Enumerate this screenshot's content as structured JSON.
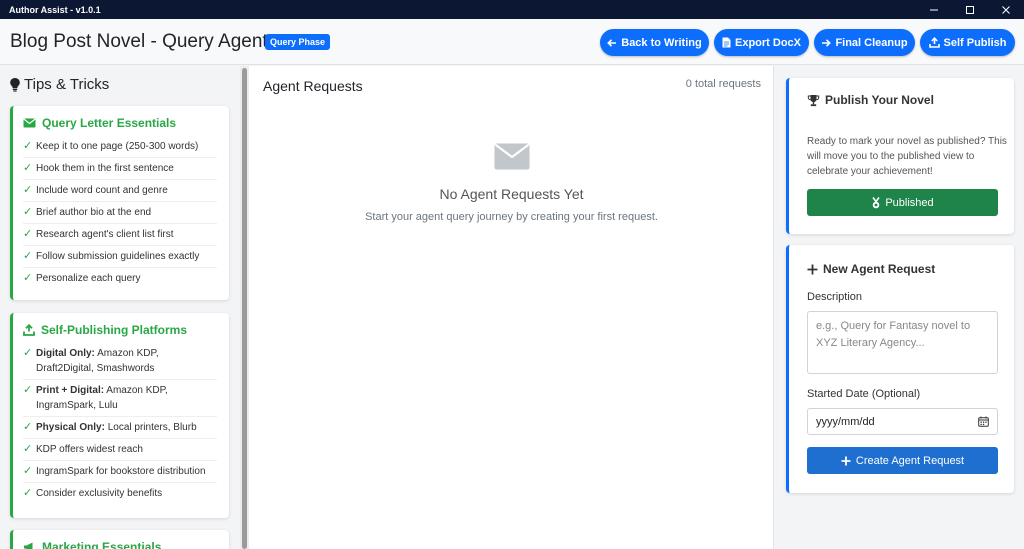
{
  "window": {
    "title": "Author Assist - v1.0.1"
  },
  "header": {
    "title": "Blog Post Novel - Query Agents",
    "phase_badge": "Query Phase",
    "buttons": {
      "back": "Back to Writing",
      "export": "Export DocX",
      "cleanup": "Final Cleanup",
      "publish": "Self Publish"
    },
    "accent": "#0d6efd"
  },
  "sidebar": {
    "title": "Tips & Tricks",
    "cards": [
      {
        "title": "Query Letter Essentials",
        "icon": "envelope-icon",
        "items": [
          {
            "bold": "",
            "text": "Keep it to one page (250-300 words)"
          },
          {
            "bold": "",
            "text": "Hook them in the first sentence"
          },
          {
            "bold": "",
            "text": "Include word count and genre"
          },
          {
            "bold": "",
            "text": "Brief author bio at the end"
          },
          {
            "bold": "",
            "text": "Research agent's client list first"
          },
          {
            "bold": "",
            "text": "Follow submission guidelines exactly"
          },
          {
            "bold": "",
            "text": "Personalize each query"
          }
        ]
      },
      {
        "title": "Self-Publishing Platforms",
        "icon": "upload-icon",
        "items": [
          {
            "bold": "Digital Only:",
            "text": "Amazon KDP, Draft2Digital, Smashwords"
          },
          {
            "bold": "Print + Digital:",
            "text": "Amazon KDP, IngramSpark, Lulu"
          },
          {
            "bold": "Physical Only:",
            "text": "Local printers, Blurb"
          },
          {
            "bold": "",
            "text": "KDP offers widest reach"
          },
          {
            "bold": "",
            "text": "IngramSpark for bookstore distribution"
          },
          {
            "bold": "",
            "text": "Consider exclusivity benefits"
          }
        ]
      },
      {
        "title": "Marketing Essentials",
        "icon": "megaphone-icon",
        "items": []
      }
    ],
    "check_glyph": "✓",
    "tip_color": "#28a745"
  },
  "main": {
    "title": "Agent Requests",
    "total": "0 total requests",
    "empty_title": "No Agent Requests Yet",
    "empty_subtitle": "Start your agent query journey by creating your first request."
  },
  "publish_card": {
    "title": "Publish Your Novel",
    "text": "Ready to mark your novel as published? This will move you to the published view to celebrate your achievement!",
    "button": "Published",
    "button_color": "#1e8449"
  },
  "request_form": {
    "title": "New Agent Request",
    "description_label": "Description",
    "description_placeholder": "e.g., Query for Fantasy novel to XYZ Literary Agency...",
    "description_value": "",
    "date_label": "Started Date (Optional)",
    "date_value": "yyyy/mm/dd",
    "submit": "Create Agent Request"
  }
}
